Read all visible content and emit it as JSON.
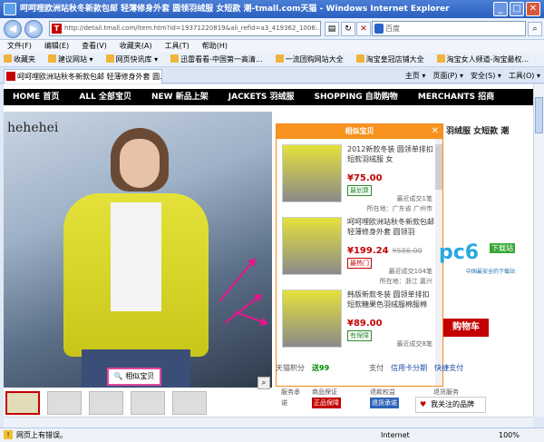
{
  "window": {
    "title": "呵呵哩欧洲站秋冬新款包邮 轻薄修身外套 圆领羽绒服 女短款 潮-tmall.com天猫 - Windows Internet Explorer"
  },
  "addressbar": {
    "url": "http://detail.tmall.com/item.htm?id=19371220819&ali_refid=a3_419362_1006:...",
    "search_placeholder": "百度"
  },
  "menu": [
    "文件(F)",
    "编辑(E)",
    "查看(V)",
    "收藏夹(A)",
    "工具(T)",
    "帮助(H)"
  ],
  "favorites": [
    "收藏夹",
    "建议网站 ▾",
    "网页快讯库 ▾",
    "迅雷看看-中国第一高清...",
    "一流团购网站大全",
    "淘宝皇冠店铺大全",
    "淘宝女人频道-淘宝最权..."
  ],
  "tab": {
    "label": "呵呵哩欧洲站秋冬新款包邮 轻薄修身外套 圆..."
  },
  "commands": [
    "主页 ▾",
    "页面(P) ▾",
    "安全(S) ▾",
    "工具(O) ▾"
  ],
  "sitenav": [
    "HOME 首页",
    "ALL 全部宝贝",
    "NEW 新品上架",
    "JACKETS 羽绒服",
    "SHOPPING 自助购物",
    "MERCHANTS 招商"
  ],
  "product": {
    "brand": "hehehei",
    "title_partial": "羽绒服 女短款 潮",
    "similar_button": "相似宝贝",
    "cart_button": "购物车",
    "points_label": "天猫积分",
    "points_value": "送99",
    "pay_label": "支付",
    "credit_card": "信用卡分期",
    "quick_pay": "快捷支付"
  },
  "service": {
    "label": "服务承诺",
    "guarantee_title": "商品保证",
    "guarantee_badge": "正品保障",
    "refund_title": "退款权益",
    "refund_badge": "退货承诺",
    "return_title": "退货服务",
    "fav_button": "我关注的品牌"
  },
  "popup": {
    "title": "相似宝贝",
    "items": [
      {
        "title": "2012新款冬装 圆领单排扣短款羽绒服 女",
        "price": "¥75.00",
        "old_price": "",
        "tag": "最划算",
        "tag_color": "#2d8a2d",
        "sold": "最近成交1笔",
        "location": "所在地：广东省 广州市"
      },
      {
        "title": "呵呵哩欧洲站秋冬新款包邮 轻薄修身外套 圆领羽",
        "price": "¥199.24",
        "old_price": "¥586.00",
        "tag": "最热门",
        "tag_color": "#c40000",
        "sold": "最近成交104笔",
        "location": "所在地：浙江 嘉兴"
      },
      {
        "title": "韩版新款冬装 圆领单排扣短款糖果色羽绒服棉服棉",
        "price": "¥89.00",
        "old_price": "",
        "tag": "有保障",
        "tag_color": "#2d8a2d",
        "sold": "最近成交8笔",
        "location": ""
      }
    ]
  },
  "watermark": {
    "logo": "pc6",
    "download": "下载站",
    "sub": "中国最安全的下载站"
  },
  "status": {
    "left": "网页上有错误。",
    "zone": "Internet",
    "zoom": "100%"
  }
}
